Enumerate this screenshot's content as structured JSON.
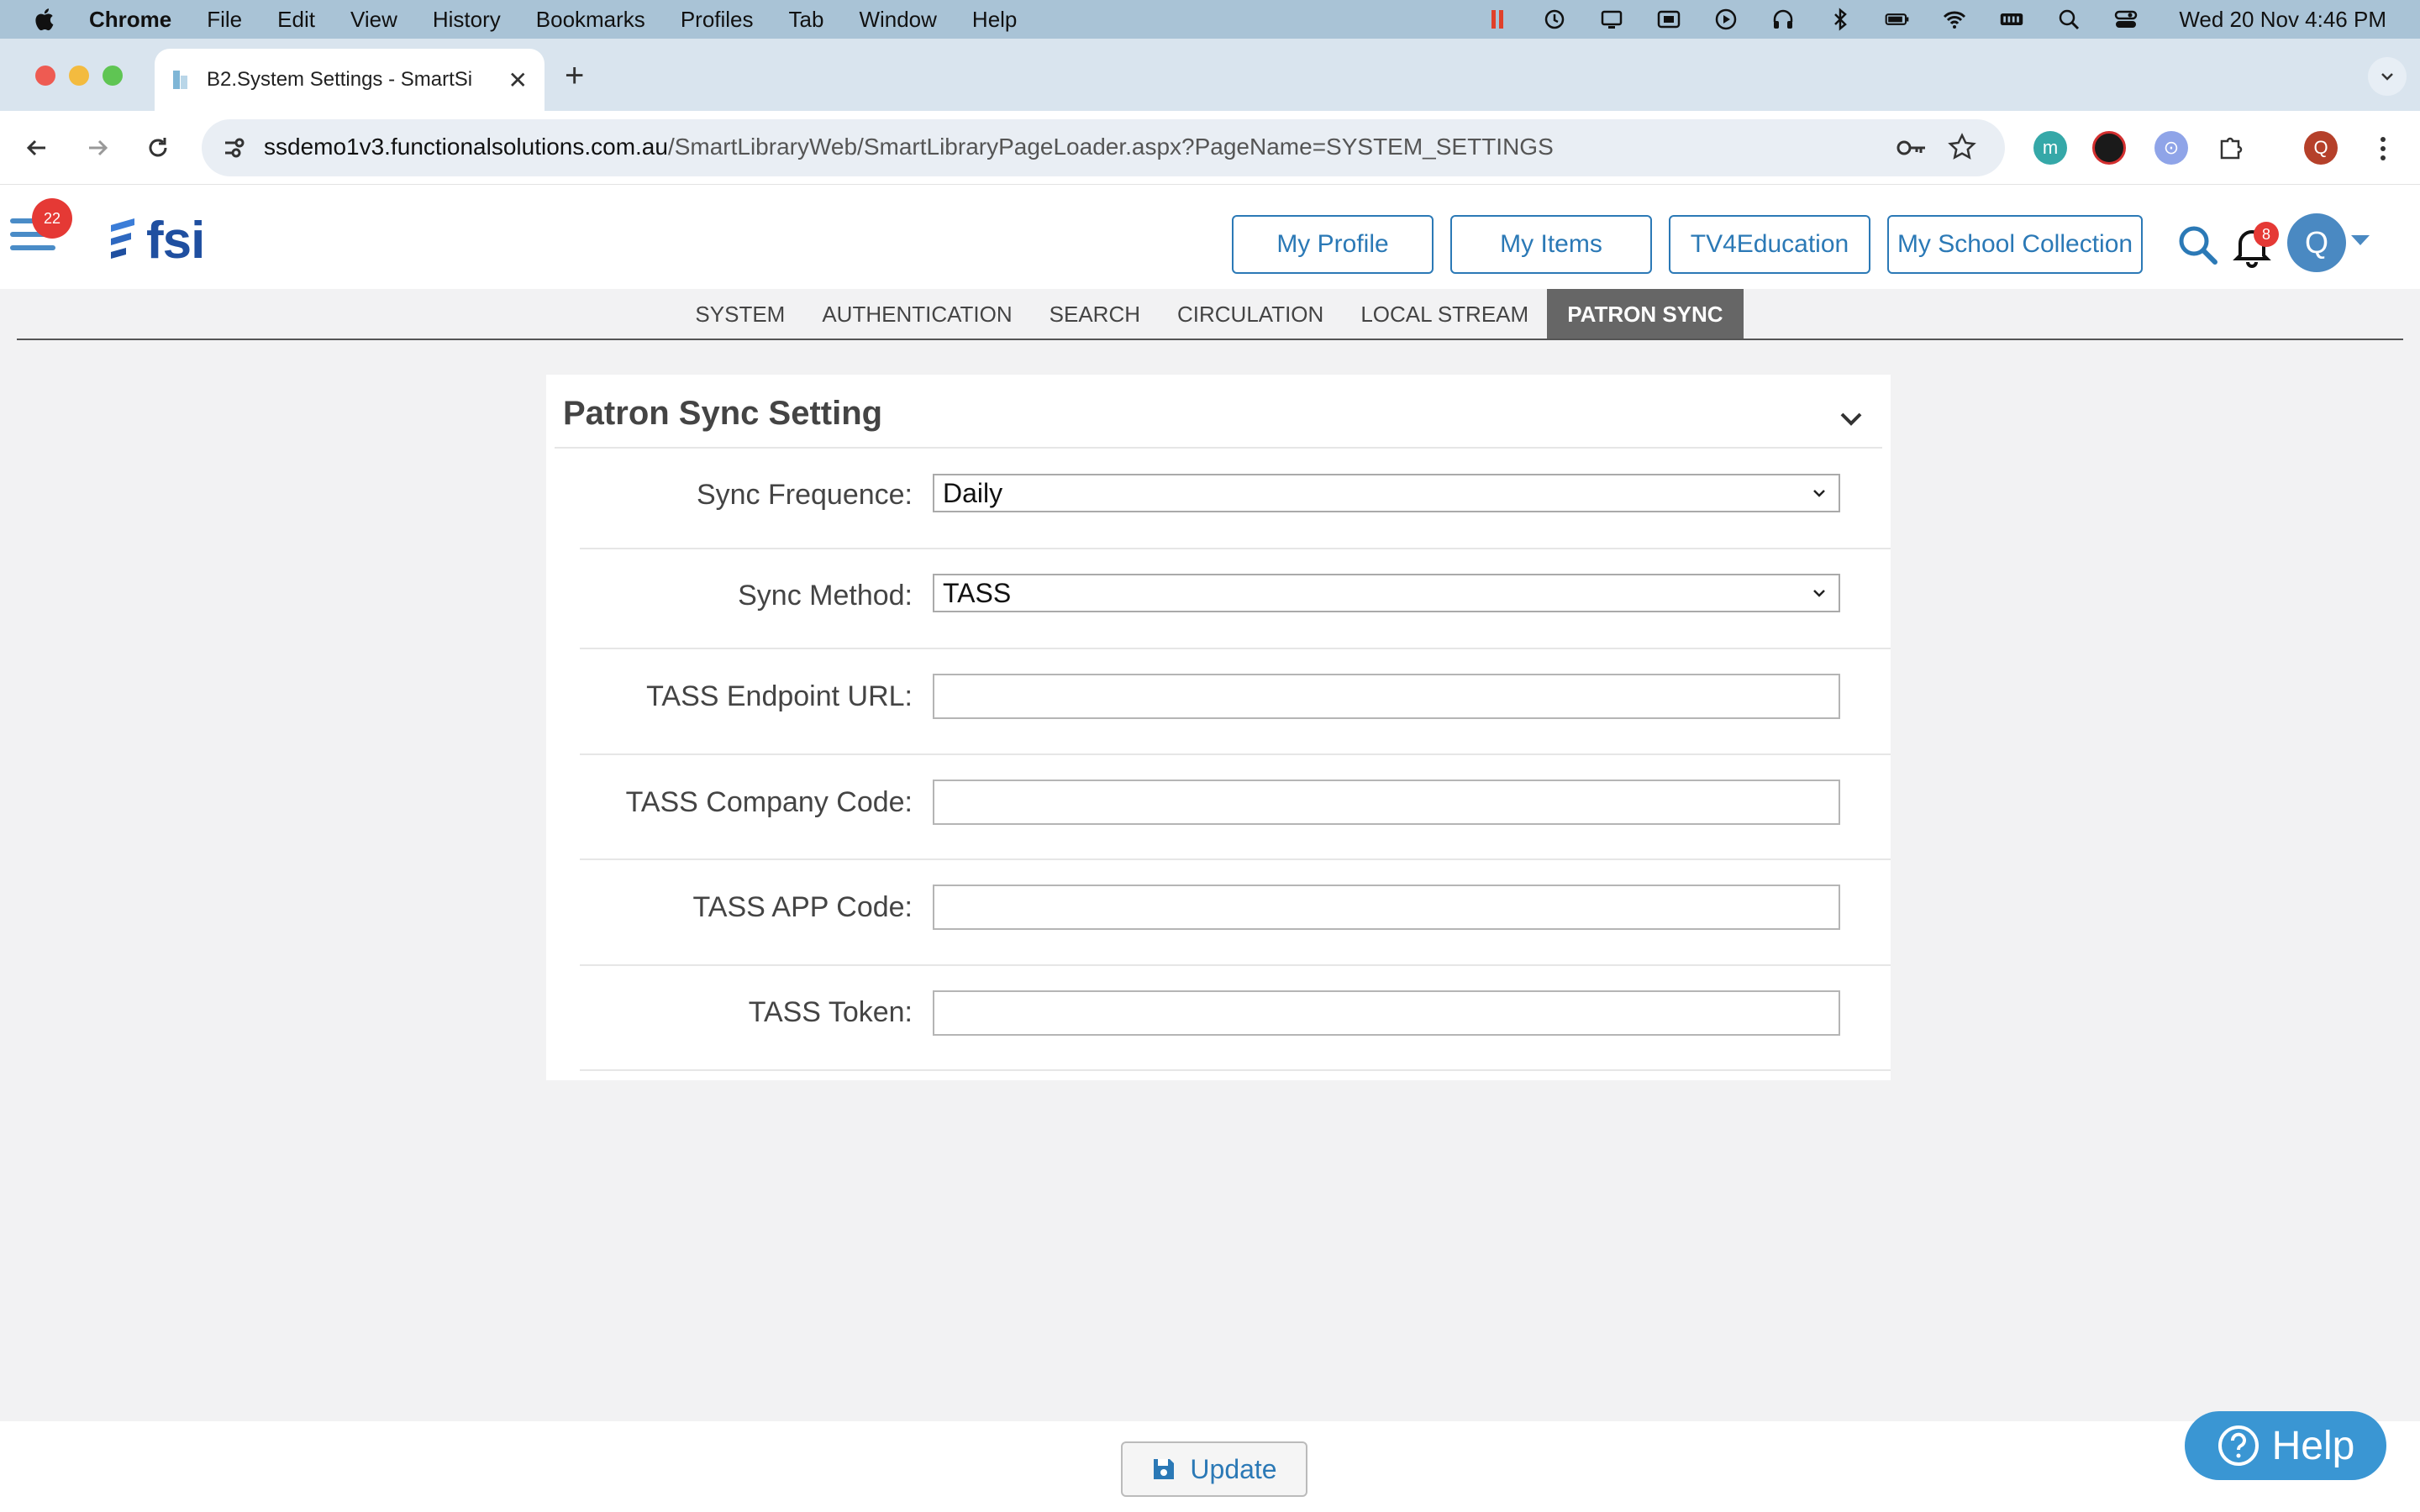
{
  "menubar": {
    "app": "Chrome",
    "items": [
      "File",
      "Edit",
      "View",
      "History",
      "Bookmarks",
      "Profiles",
      "Tab",
      "Window",
      "Help"
    ],
    "clock": "Wed 20 Nov  4:46 PM"
  },
  "browser": {
    "tab_title": "B2.System Settings - SmartSi",
    "url_host": "ssdemo1v3.functionalsolutions.com.au",
    "url_path": "/SmartLibraryWeb/SmartLibraryPageLoader.aspx?PageName=SYSTEM_SETTINGS",
    "profile_initial": "Q",
    "ext_m": "m"
  },
  "header": {
    "menu_badge": "22",
    "logo_text": "fsi",
    "buttons": [
      "My Profile",
      "My Items",
      "TV4Education",
      "My School Collection"
    ],
    "bell_badge": "8",
    "avatar_initial": "Q"
  },
  "settings_tabs": [
    {
      "label": "SYSTEM",
      "active": false
    },
    {
      "label": "AUTHENTICATION",
      "active": false
    },
    {
      "label": "SEARCH",
      "active": false
    },
    {
      "label": "CIRCULATION",
      "active": false
    },
    {
      "label": "LOCAL STREAM",
      "active": false
    },
    {
      "label": "PATRON SYNC",
      "active": true
    }
  ],
  "panel": {
    "title": "Patron Sync Setting",
    "fields": {
      "sync_frequence": {
        "label": "Sync Frequence:",
        "value": "Daily"
      },
      "sync_method": {
        "label": "Sync Method:",
        "value": "TASS"
      },
      "tass_endpoint_url": {
        "label": "TASS Endpoint URL:",
        "value": ""
      },
      "tass_company_code": {
        "label": "TASS Company Code:",
        "value": ""
      },
      "tass_app_code": {
        "label": "TASS APP Code:",
        "value": ""
      },
      "tass_token": {
        "label": "TASS Token:",
        "value": ""
      }
    }
  },
  "footer": {
    "update_label": "Update",
    "help_label": "Help"
  },
  "colors": {
    "brand_blue": "#2b79b6",
    "badge_red": "#e53935",
    "active_tab": "#666666",
    "help_bg": "#3a96d3"
  }
}
